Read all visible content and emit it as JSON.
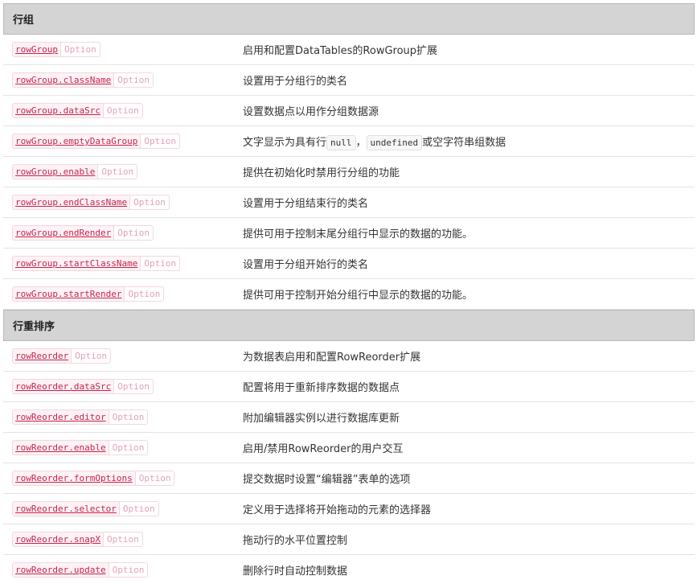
{
  "sections": [
    {
      "title": "行组",
      "rows": [
        {
          "name": "rowGroup",
          "type": "Option",
          "desc": "启用和配置DataTables的RowGroup扩展"
        },
        {
          "name": "rowGroup.className",
          "type": "Option",
          "desc": "设置用于分组行的类名"
        },
        {
          "name": "rowGroup.dataSrc",
          "type": "Option",
          "desc": "设置数据点以用作分组数据源"
        },
        {
          "name": "rowGroup.emptyDataGroup",
          "type": "Option",
          "desc_pre": "文字显示为具有行",
          "code1": "null",
          "desc_mid": "，",
          "code2": "undefined",
          "desc_post": "或空字符串组数据"
        },
        {
          "name": "rowGroup.enable",
          "type": "Option",
          "desc": "提供在初始化时禁用行分组的功能"
        },
        {
          "name": "rowGroup.endClassName",
          "type": "Option",
          "desc": "设置用于分组结束行的类名"
        },
        {
          "name": "rowGroup.endRender",
          "type": "Option",
          "desc": "提供可用于控制末尾分组行中显示的数据的功能。"
        },
        {
          "name": "rowGroup.startClassName",
          "type": "Option",
          "desc": "设置用于分组开始行的类名"
        },
        {
          "name": "rowGroup.startRender",
          "type": "Option",
          "desc": "提供可用于控制开始分组行中显示的数据的功能。"
        }
      ]
    },
    {
      "title": "行重排序",
      "rows": [
        {
          "name": "rowReorder",
          "type": "Option",
          "desc": "为数据表启用和配置RowReorder扩展"
        },
        {
          "name": "rowReorder.dataSrc",
          "type": "Option",
          "desc": "配置将用于重新排序数据的数据点"
        },
        {
          "name": "rowReorder.editor",
          "type": "Option",
          "desc": "附加编辑器实例以进行数据库更新"
        },
        {
          "name": "rowReorder.enable",
          "type": "Option",
          "desc": "启用/禁用RowReorder的用户交互"
        },
        {
          "name": "rowReorder.formOptions",
          "type": "Option",
          "desc": "提交数据时设置“编辑器”表单的选项"
        },
        {
          "name": "rowReorder.selector",
          "type": "Option",
          "desc": "定义用于选择将开始拖动的元素的选择器"
        },
        {
          "name": "rowReorder.snapX",
          "type": "Option",
          "desc": "拖动行的水平位置控制"
        },
        {
          "name": "rowReorder.update",
          "type": "Option",
          "desc": "删除行时自动控制数据"
        }
      ]
    }
  ]
}
